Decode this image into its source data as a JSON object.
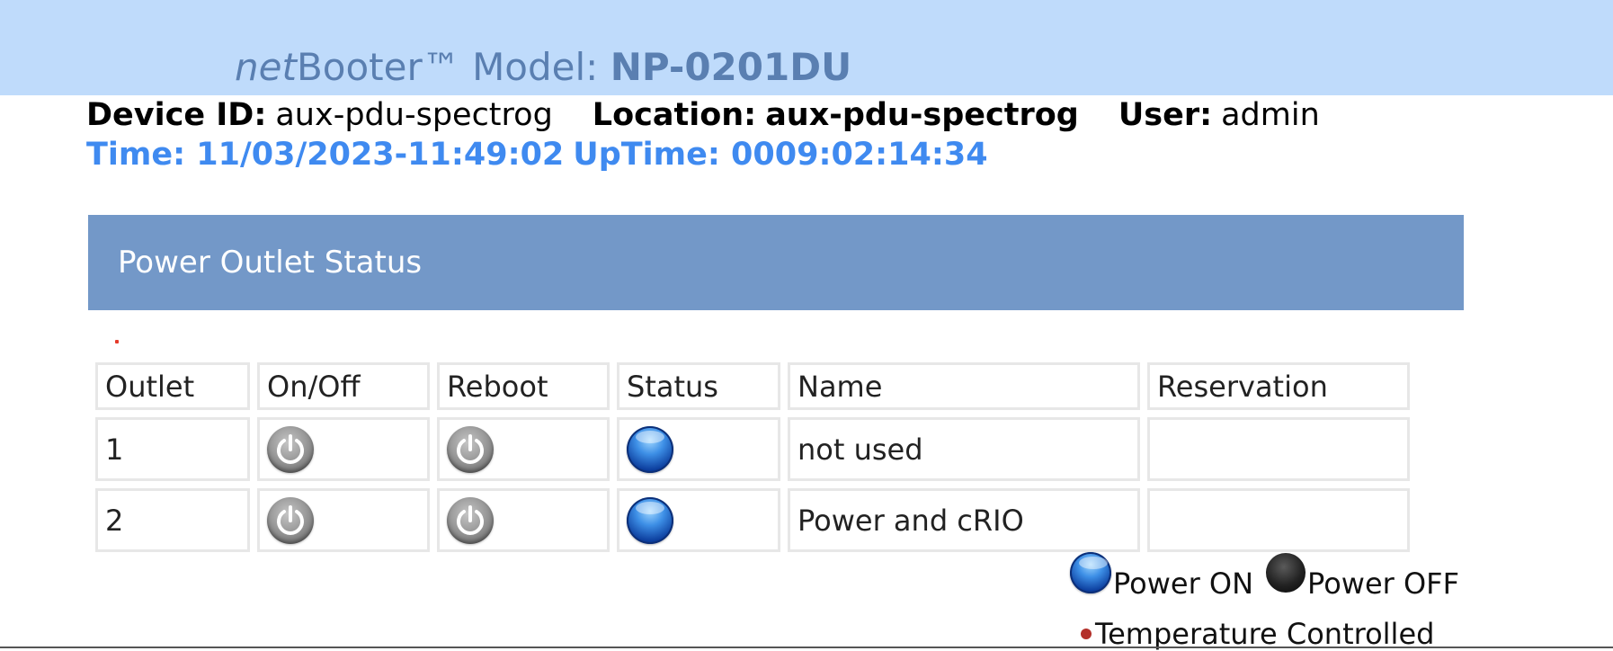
{
  "header": {
    "brand_italic": "net",
    "brand_rest": "Booter™ Model: ",
    "model": "NP-0201DU"
  },
  "device_info": {
    "device_id_label": "Device ID:",
    "device_id_value": "aux-pdu-spectrog",
    "location_label": "Location:",
    "location_value": "aux-pdu-spectrog",
    "user_label": "User:",
    "user_value": "admin",
    "time_text": "Time: 11/03/2023-11:49:02",
    "uptime_text": "UpTime: 0009:02:14:34"
  },
  "panel": {
    "title": "Power Outlet Status"
  },
  "table": {
    "headers": [
      "Outlet",
      "On/Off",
      "Reboot",
      "Status",
      "Name",
      "Reservation"
    ],
    "rows": [
      {
        "outlet": "1",
        "status": "on",
        "name": "not used",
        "reservation": ""
      },
      {
        "outlet": "2",
        "status": "on",
        "name": "Power and cRIO",
        "reservation": ""
      }
    ]
  },
  "legend": {
    "on_label": "Power ON",
    "off_label": "Power OFF",
    "temp_label": "Temperature Controlled"
  },
  "colors": {
    "header_band": "#bfdbfb",
    "header_text": "#5a7fb1",
    "time_text": "#3f8af0",
    "panel_header": "#7398c8",
    "status_on": "#0b3c9c",
    "temp_dot": "#b3302a"
  },
  "icons": {
    "onoff": "power-icon",
    "reboot": "power-icon",
    "status_on": "blue-orb-icon",
    "status_off": "black-orb-icon",
    "temp": "red-dot-icon"
  }
}
